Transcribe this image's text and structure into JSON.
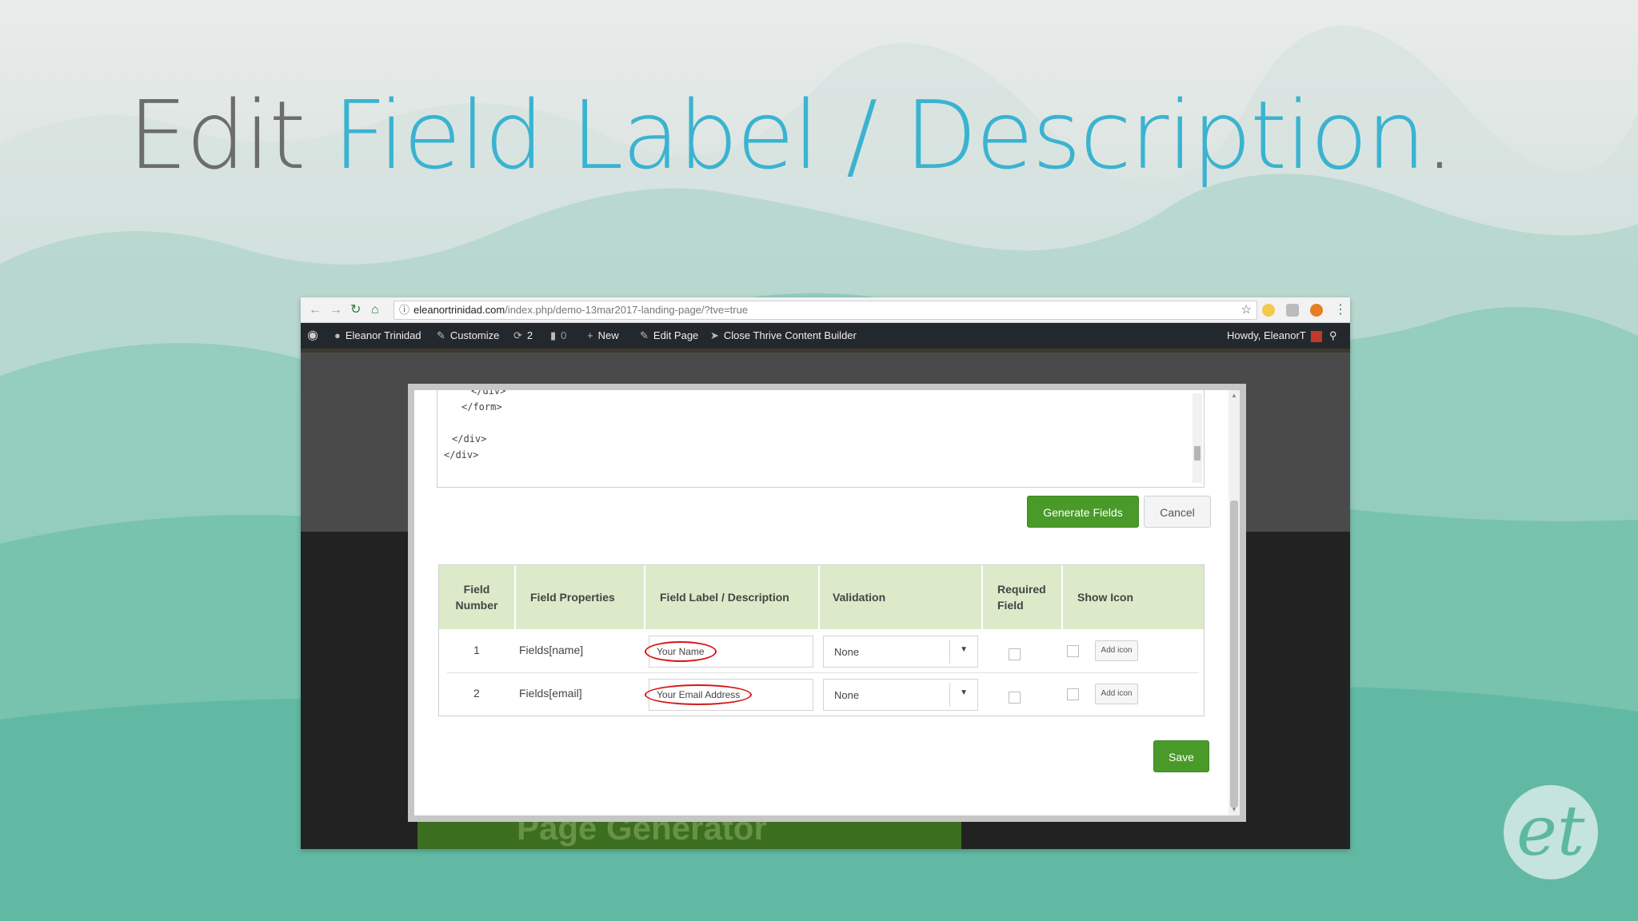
{
  "slide": {
    "title_part1": "Edit ",
    "title_part2": "Field Label / Description",
    "title_part3": "."
  },
  "browser": {
    "url_domain": "eleanortrinidad.com",
    "url_path": "/index.php/demo-13mar2017-landing-page/?tve=true"
  },
  "admin_bar": {
    "site_name": "Eleanor Trinidad",
    "customize": "Customize",
    "updates_count": "2",
    "comments_count": "0",
    "new": "New",
    "edit_page": "Edit Page",
    "close_builder": "Close Thrive Content Builder",
    "howdy": "Howdy, EleanorT"
  },
  "code_lines": [
    "</div>",
    "</form>",
    "</div>",
    "</div>"
  ],
  "buttons": {
    "generate_fields": "Generate Fields",
    "cancel": "Cancel",
    "save": "Save"
  },
  "table": {
    "headers": {
      "field_number": "Field\nNumber",
      "field_properties": "Field Properties",
      "field_label": "Field Label / Description",
      "validation": "Validation",
      "required": "Required\nField",
      "show_icon": "Show Icon"
    },
    "rows": [
      {
        "number": "1",
        "property": "Fields[name]",
        "label": "Your Name",
        "validation": "None",
        "add_icon": "Add icon"
      },
      {
        "number": "2",
        "property": "Fields[email]",
        "label": "Your Email Address",
        "validation": "None",
        "add_icon": "Add icon"
      }
    ]
  },
  "background_text": "Page Generator",
  "logo_text": "et",
  "colors": {
    "accent_blue": "#3bb3d0",
    "button_green": "#4a9a2a",
    "header_green": "#dceac9",
    "highlight_red": "#d61818"
  }
}
